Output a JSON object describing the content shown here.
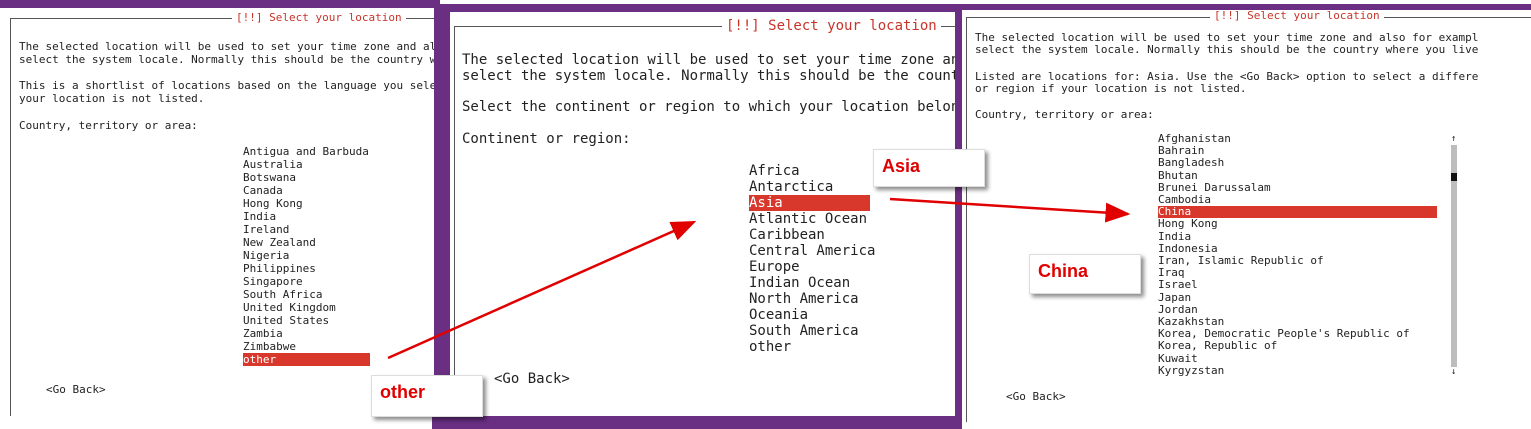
{
  "panel1": {
    "title": "[!!] Select your location",
    "description": "The selected location will be used to set your time zone and al\nselect the system locale. Normally this should be the country w",
    "shortlist_note": "This is a shortlist of locations based on the language you sele\nyour location is not listed.",
    "prompt": "Country, territory or area:",
    "items": [
      "Antigua and Barbuda",
      "Australia",
      "Botswana",
      "Canada",
      "Hong Kong",
      "India",
      "Ireland",
      "New Zealand",
      "Nigeria",
      "Philippines",
      "Singapore",
      "South Africa",
      "United Kingdom",
      "United States",
      "Zambia",
      "Zimbabwe",
      "other"
    ],
    "selected": "other",
    "go_back": "<Go Back>"
  },
  "panel2": {
    "title": "[!!] Select your location",
    "description": "The selected location will be used to set your time zone and a\nselect the system locale. Normally this should be the country",
    "prompt_region": "Select the continent or region to which your location belongs.",
    "prompt": "Continent or region:",
    "items": [
      "Africa",
      "Antarctica",
      "Asia",
      "Atlantic Ocean",
      "Caribbean",
      "Central America",
      "Europe",
      "Indian Ocean",
      "North America",
      "Oceania",
      "South America",
      "other"
    ],
    "selected": "Asia",
    "go_back": "<Go Back>"
  },
  "panel3": {
    "title": "[!!] Select your location",
    "description": "The selected location will be used to set your time zone and also for exampl\nselect the system locale. Normally this should be the country where you live",
    "listed_note": "Listed are locations for: Asia. Use the <Go Back> option to select a differe\nor region if your location is not listed.",
    "prompt": "Country, territory or area:",
    "items": [
      "Afghanistan",
      "Bahrain",
      "Bangladesh",
      "Bhutan",
      "Brunei Darussalam",
      "Cambodia",
      "China",
      "Hong Kong",
      "India",
      "Indonesia",
      "Iran, Islamic Republic of",
      "Iraq",
      "Israel",
      "Japan",
      "Jordan",
      "Kazakhstan",
      "Korea, Democratic People's Republic of",
      "Korea, Republic of",
      "Kuwait",
      "Kyrgyzstan"
    ],
    "selected": "China",
    "go_back": "<Go Back>",
    "scroll_up": "↑",
    "scroll_down": "↓"
  },
  "callouts": {
    "other": "other",
    "asia": "Asia",
    "china": "China"
  },
  "colors": {
    "selection": "#d7382b",
    "title": "#c8342a",
    "annotation_arrow": "#e00000",
    "window_purple": "#6a2f82"
  }
}
